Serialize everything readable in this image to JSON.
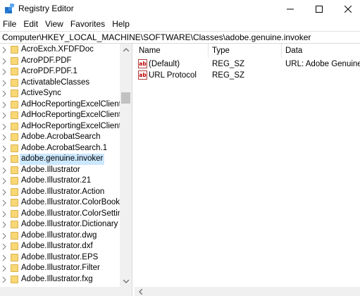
{
  "window": {
    "title": "Registry Editor",
    "icon": "registry-editor-icon"
  },
  "menu": {
    "items": [
      "File",
      "Edit",
      "View",
      "Favorites",
      "Help"
    ]
  },
  "address": {
    "path": "Computer\\HKEY_LOCAL_MACHINE\\SOFTWARE\\Classes\\adobe.genuine.invoker"
  },
  "tree": {
    "items": [
      {
        "label": "AcroExch.XFDFDoc",
        "selected": false
      },
      {
        "label": "AcroPDF.PDF",
        "selected": false
      },
      {
        "label": "AcroPDF.PDF.1",
        "selected": false
      },
      {
        "label": "ActivatableClasses",
        "selected": false
      },
      {
        "label": "ActiveSync",
        "selected": false
      },
      {
        "label": "AdHocReportingExcelClientLib",
        "selected": false
      },
      {
        "label": "AdHocReportingExcelClientLib",
        "selected": false
      },
      {
        "label": "AdHocReportingExcelClientLib",
        "selected": false
      },
      {
        "label": "Adobe.AcrobatSearch",
        "selected": false
      },
      {
        "label": "Adobe.AcrobatSearch.1",
        "selected": false
      },
      {
        "label": "adobe.genuine.invoker",
        "selected": true
      },
      {
        "label": "Adobe.Illustrator",
        "selected": false
      },
      {
        "label": "Adobe.Illustrator.21",
        "selected": false
      },
      {
        "label": "Adobe.Illustrator.Action",
        "selected": false
      },
      {
        "label": "Adobe.Illustrator.ColorBook",
        "selected": false
      },
      {
        "label": "Adobe.Illustrator.ColorSettings",
        "selected": false
      },
      {
        "label": "Adobe.Illustrator.Dictionary",
        "selected": false
      },
      {
        "label": "Adobe.Illustrator.dwg",
        "selected": false
      },
      {
        "label": "Adobe.Illustrator.dxf",
        "selected": false
      },
      {
        "label": "Adobe.Illustrator.EPS",
        "selected": false
      },
      {
        "label": "Adobe.Illustrator.Filter",
        "selected": false
      },
      {
        "label": "Adobe.Illustrator.fxg",
        "selected": false
      }
    ]
  },
  "values": {
    "columns": {
      "name": "Name",
      "type": "Type",
      "data": "Data"
    },
    "rows": [
      {
        "name": "(Default)",
        "type": "REG_SZ",
        "data": "URL: Adobe Genuine Invoker",
        "icon": "string-value-icon"
      },
      {
        "name": "URL Protocol",
        "type": "REG_SZ",
        "data": "",
        "icon": "string-value-icon"
      }
    ]
  },
  "colors": {
    "selection": "#cce8ff",
    "folder": "#f8d775",
    "scrollbar_track": "#f0f0f0"
  }
}
